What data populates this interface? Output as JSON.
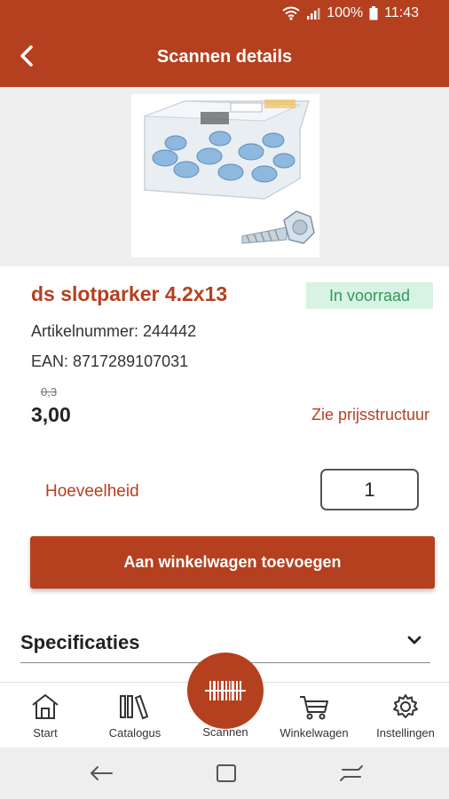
{
  "status_bar": {
    "battery": "100%",
    "time": "11:43"
  },
  "header": {
    "title": "Scannen details"
  },
  "product": {
    "title": "ds slotparker 4.2x13",
    "stock": "In voorraad",
    "article": "Artikelnummer: 244442",
    "ean": "EAN: 8717289107031",
    "old_price": "0,3",
    "price": "3,00",
    "price_link": "Zie prijsstructuur"
  },
  "quantity": {
    "label": "Hoeveelheid",
    "value": "1"
  },
  "actions": {
    "add_to_cart": "Aan winkelwagen toevoegen"
  },
  "specs": {
    "label": "Specificaties"
  },
  "bottom_nav": {
    "items": [
      {
        "label": "Start",
        "icon": "home-icon"
      },
      {
        "label": "Catalogus",
        "icon": "catalog-icon"
      },
      {
        "label": "Scannen",
        "icon": "barcode-scan-icon"
      },
      {
        "label": "Winkelwagen",
        "icon": "cart-icon"
      },
      {
        "label": "Instellingen",
        "icon": "gear-icon"
      }
    ]
  },
  "colors": {
    "brand": "#b5401f",
    "stock_bg": "#d8f2e3",
    "stock_text": "#2f9a5a"
  }
}
